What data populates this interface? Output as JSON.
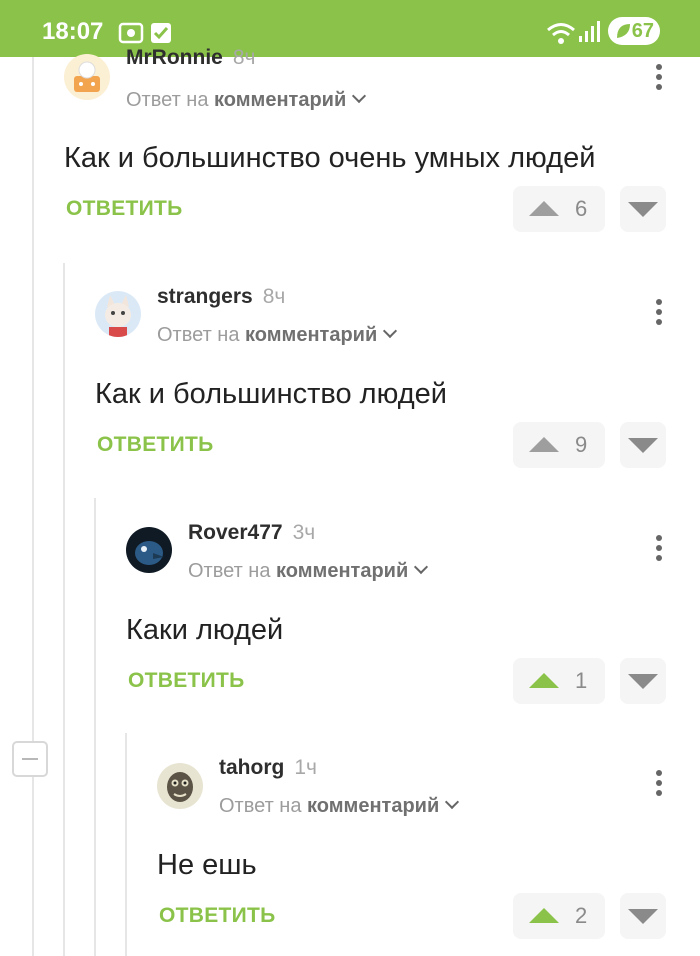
{
  "status_bar": {
    "time": "18:07",
    "battery": "67"
  },
  "comments": [
    {
      "author": "MrRonnie",
      "time": "8ч",
      "reply_prefix": "Ответ на",
      "reply_target": "комментарий",
      "text": "Как и большинство очень умных людей",
      "reply_label": "ОТВЕТИТЬ",
      "rating": "6",
      "upvoted": false
    },
    {
      "author": "strangers",
      "time": "8ч",
      "reply_prefix": "Ответ на",
      "reply_target": "комментарий",
      "text": "Как и большинство людей",
      "reply_label": "ОТВЕТИТЬ",
      "rating": "9",
      "upvoted": false
    },
    {
      "author": "Rover477",
      "time": "3ч",
      "reply_prefix": "Ответ на",
      "reply_target": "комментарий",
      "text": "Каки людей",
      "reply_label": "ОТВЕТИТЬ",
      "rating": "1",
      "upvoted": true
    },
    {
      "author": "tahorg",
      "time": "1ч",
      "reply_prefix": "Ответ на",
      "reply_target": "комментарий",
      "text": "Не ешь",
      "reply_label": "ОТВЕТИТЬ",
      "rating": "2",
      "upvoted": true
    }
  ],
  "colors": {
    "accent": "#8bc34a",
    "text": "#222222",
    "muted": "#9c9c9c"
  },
  "icons": {
    "more": "more-vertical-icon",
    "up": "upvote-icon",
    "down": "downvote-icon",
    "collapse": "collapse-icon"
  }
}
